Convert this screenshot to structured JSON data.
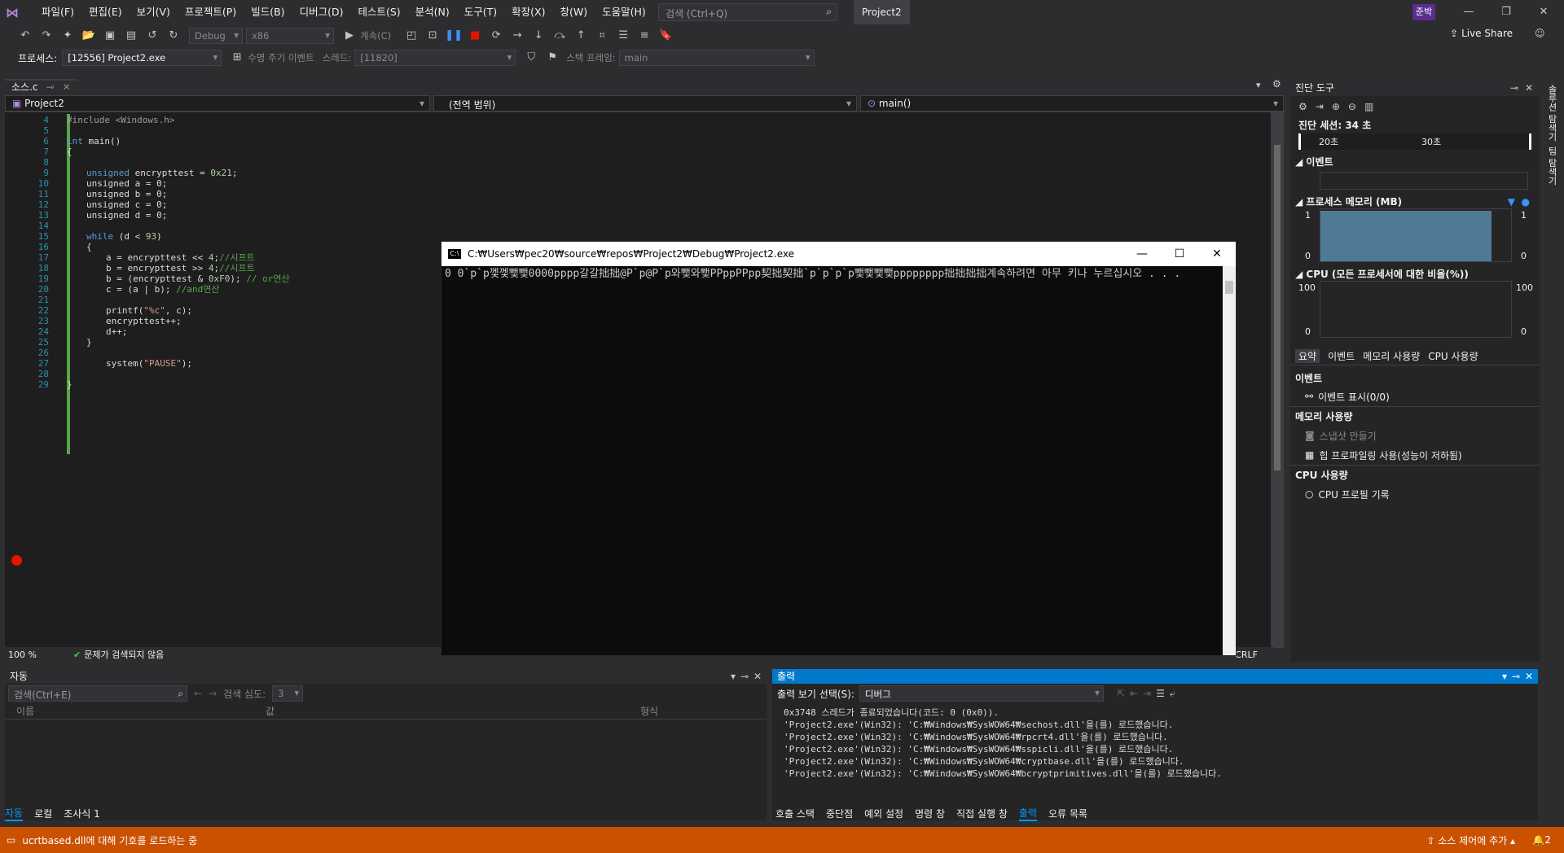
{
  "menu": [
    "파일(F)",
    "편집(E)",
    "보기(V)",
    "프로젝트(P)",
    "빌드(B)",
    "디버그(D)",
    "테스트(S)",
    "분석(N)",
    "도구(T)",
    "확장(X)",
    "창(W)",
    "도움말(H)"
  ],
  "search": {
    "placeholder": "검색 (Ctrl+Q)"
  },
  "project_name": "Project2",
  "user_badge": "준박",
  "toolbar": {
    "config": "Debug",
    "platform": "x86",
    "continue": "계속(C)",
    "live_share": "Live Share"
  },
  "toolbar2": {
    "process_label": "프로세스:",
    "process_value": "[12556] Project2.exe",
    "lifecycle": "수명 주기 이벤트",
    "thread_label": "스레드:",
    "thread_value": "[11820]",
    "stack_label": "스택 프레임:",
    "stack_value": "main"
  },
  "tab": {
    "filename": "소스.c"
  },
  "nav": {
    "project": "Project2",
    "scope": "(전역 범위)",
    "function": "main()"
  },
  "code_lines": [
    {
      "n": "4"
    },
    {
      "n": "5"
    },
    {
      "n": "6"
    },
    {
      "n": "7"
    },
    {
      "n": "8"
    },
    {
      "n": "9"
    },
    {
      "n": "10"
    },
    {
      "n": "11"
    },
    {
      "n": "12"
    },
    {
      "n": "13"
    },
    {
      "n": "14"
    },
    {
      "n": "15"
    },
    {
      "n": "16"
    },
    {
      "n": "17"
    },
    {
      "n": "18"
    },
    {
      "n": "19"
    },
    {
      "n": "20"
    },
    {
      "n": "21"
    },
    {
      "n": "22"
    },
    {
      "n": "23"
    },
    {
      "n": "24"
    },
    {
      "n": "25"
    },
    {
      "n": "26"
    },
    {
      "n": "27"
    },
    {
      "n": "28"
    },
    {
      "n": "29"
    }
  ],
  "code": {
    "l4": "#include <Windows.h>",
    "l6a": "int",
    " l6b": " main()",
    "l7": "{",
    "l9a": "unsigned",
    "l9b": " encrypttest = ",
    "l9c": "0x21",
    ";": ";",
    "l10": "unsigned a = 0;",
    "l11": "unsigned b = 0;",
    "l12": "unsigned c = 0;",
    "l13": "unsigned d = 0;",
    "l15a": "while",
    "l15b": " (d < ",
    "l15c": "93",
    ")": ")",
    "l16": "{",
    "l17a": "a = encrypttest << ",
    "l17b": "4",
    "l17c": "//시프트",
    "l18a": "b = encrypttest >> ",
    "l18b": "4",
    "l18c": "//시프트",
    "l19a": "b = (encrypttest & ",
    "l19b": "0xF0",
    "l19c": "); ",
    "l19d": "// or연산",
    "l20a": "c = (a | b); ",
    "l20b": "//and연산",
    "l22a": "printf(",
    "l22b": "\"%c\"",
    "l22c": ", c);",
    "l23": "encrypttest++;",
    "l24": "d++;",
    "l25": "}",
    "l27a": "system(",
    "l27b": "\"PAUSE\"",
    "l27c": ");",
    "l29": "}"
  },
  "editor_status": {
    "zoom": "100 %",
    "issues": "문제가 검색되지 않음",
    "eol": "CRLF"
  },
  "console": {
    "title": "C:₩Users₩pec20₩source₩repos₩Project2₩Debug₩Project2.exe",
    "text": "0 0`p`p껯껯뾏뾏0000pppp갈갈拙拙@P`p@P`p와뾏와뾏PPppPPpp契拙契拙`p`p`p`p뾏뾏뾏뾏pppppppp拙拙拙拙계속하려면 아무 키나 누르십시오 . . ."
  },
  "diag": {
    "title": "진단 도구",
    "session": "진단 세션: 34 초",
    "t20": "20초",
    "t30": "30초",
    "events": "이벤트",
    "memory": "프로세스 메모리 (MB)",
    "mem_top": "1",
    "mem_bottom": "0",
    "cpu": "CPU (모든 프로세서에 대한 비율(%))",
    "cpu_top": "100",
    "cpu_bottom": "0",
    "tabs": [
      "요약",
      "이벤트",
      "메모리 사용량",
      "CPU 사용량"
    ],
    "ev_head": "이벤트",
    "ev_item": "이벤트 표시(0/0)",
    "mem_head": "메모리 사용량",
    "snapshot": "스냅샷 만들기",
    "heap": "힙 프로파일링 사용(성능이 저하됨)",
    "cpu_head": "CPU 사용량",
    "cpu_rec": "CPU 프로필 기록"
  },
  "rightrail": [
    "솔루션 탐색기",
    "팀 탐색기"
  ],
  "auto": {
    "title": "자동",
    "search_ph": "검색(Ctrl+E)",
    "depth_label": "검색 심도:",
    "depth": "3",
    "col_name": "이름",
    "col_value": "값",
    "col_type": "형식"
  },
  "output": {
    "title": "출력",
    "source_label": "출력 보기 선택(S):",
    "source": "디버그",
    "lines": [
      "0x3748 스레드가 종료되었습니다(코드: 0 (0x0)).",
      "'Project2.exe'(Win32): 'C:₩Windows₩SysWOW64₩sechost.dll'을(를) 로드했습니다.",
      "'Project2.exe'(Win32): 'C:₩Windows₩SysWOW64₩rpcrt4.dll'을(를) 로드했습니다.",
      "'Project2.exe'(Win32): 'C:₩Windows₩SysWOW64₩sspicli.dll'을(를) 로드했습니다.",
      "'Project2.exe'(Win32): 'C:₩Windows₩SysWOW64₩cryptbase.dll'을(를) 로드했습니다.",
      "'Project2.exe'(Win32): 'C:₩Windows₩SysWOW64₩bcryptprimitives.dll'을(를) 로드했습니다."
    ]
  },
  "bottom_tabs_left": [
    "자동",
    "로컬",
    "조사식 1"
  ],
  "bottom_tabs_right": [
    "호출 스택",
    "중단점",
    "예외 설정",
    "명령 창",
    "직접 실행 창",
    "출력",
    "오류 목록"
  ],
  "status": {
    "left": "ucrtbased.dll에 대해 기호를 로드하는 중",
    "right": "소스 제어에 추가",
    "badge": "2"
  }
}
